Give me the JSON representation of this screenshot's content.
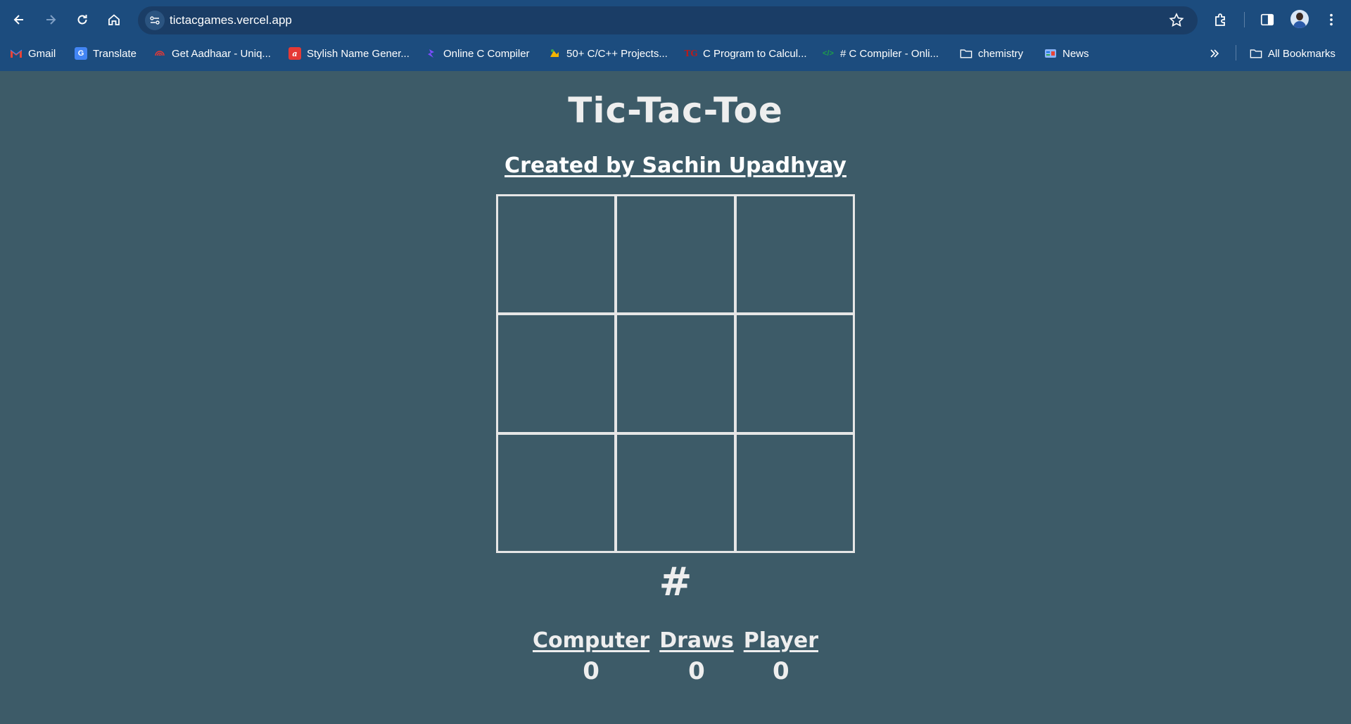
{
  "browser": {
    "url": "tictacgames.vercel.app",
    "bookmarks": [
      {
        "label": "Gmail",
        "icon": "gmail-icon"
      },
      {
        "label": "Translate",
        "icon": "translate-icon"
      },
      {
        "label": "Get Aadhaar - Uniq...",
        "icon": "aadhaar-icon"
      },
      {
        "label": "Stylish Name Gener...",
        "icon": "stylish-name-icon"
      },
      {
        "label": "Online C Compiler",
        "icon": "compiler-icon"
      },
      {
        "label": "50+ C/C++ Projects...",
        "icon": "projects-icon"
      },
      {
        "label": "C Program to Calcul...",
        "icon": "tg-icon"
      },
      {
        "label": "# C Compiler - Onli...",
        "icon": "code-icon"
      },
      {
        "label": "chemistry",
        "icon": "folder-icon"
      },
      {
        "label": "News",
        "icon": "news-icon"
      }
    ],
    "all_bookmarks": "All Bookmarks",
    "colors": {
      "chrome": "#1c4c7e",
      "page_bg": "#3d5b68"
    }
  },
  "game": {
    "title": "Tic-Tac-Toe",
    "credit": "Created by Sachin Upadhyay",
    "board": [
      "",
      "",
      "",
      "",
      "",
      "",
      "",
      "",
      ""
    ],
    "status": "#",
    "scores": [
      {
        "label": "Computer",
        "value": "0"
      },
      {
        "label": "Draws",
        "value": "0"
      },
      {
        "label": "Player",
        "value": "0"
      }
    ]
  }
}
